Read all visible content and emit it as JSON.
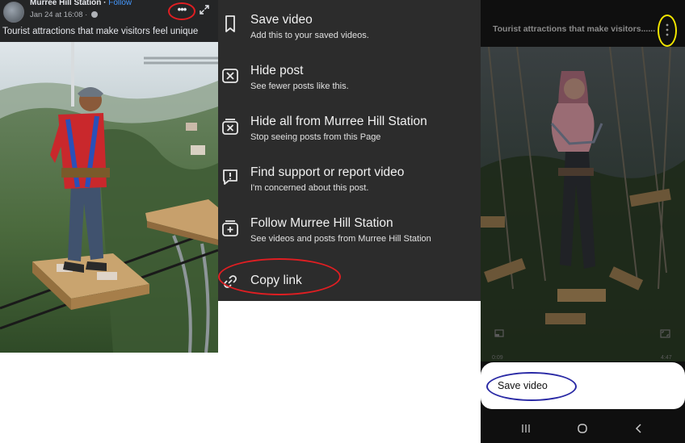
{
  "post": {
    "page_name": "Murree Hill Station",
    "separator": " · ",
    "follow_label": "Follow",
    "date": "Jan 24 at 16:08 · ",
    "caption": "Tourist attractions that make visitors feel unique"
  },
  "menu": {
    "items": [
      {
        "title": "Save video",
        "subtitle": "Add this to your saved videos.",
        "icon": "bookmark-icon"
      },
      {
        "title": "Hide post",
        "subtitle": "See fewer posts like this.",
        "icon": "hide-icon"
      },
      {
        "title": "Hide all from Murree Hill Station",
        "subtitle": "Stop seeing posts from this Page",
        "icon": "hide-all-icon"
      },
      {
        "title": "Find support or report video",
        "subtitle": "I'm concerned about this post.",
        "icon": "report-icon"
      },
      {
        "title": "Follow Murree Hill Station",
        "subtitle": "See videos and posts from Murree Hill Station",
        "icon": "follow-icon"
      },
      {
        "title": "Copy link",
        "subtitle": "",
        "icon": "link-icon"
      }
    ]
  },
  "video": {
    "title": "Tourist attractions that make visitors......",
    "time_elapsed": "0:09",
    "time_total": "4:47",
    "sheet_option": "Save video"
  },
  "colors": {
    "annotation_red": "#e01e22",
    "annotation_yellow": "#f2e600",
    "annotation_blue": "#2a2aa5",
    "follow_blue": "#4599ff"
  }
}
